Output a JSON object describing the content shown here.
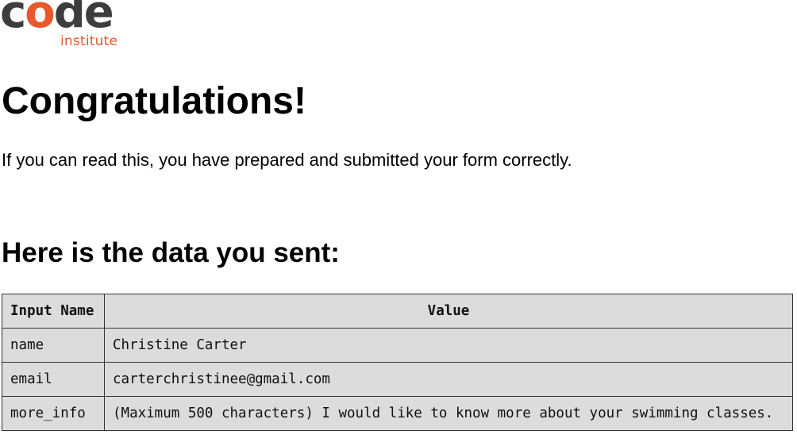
{
  "logo": {
    "word_prefix": "c",
    "word_accent": "o",
    "word_suffix": "de",
    "subtitle": "institute",
    "colors": {
      "primary": "#3d3d3d",
      "accent": "#e8582b"
    }
  },
  "page": {
    "title": "Congratulations!",
    "intro": "If you can read this, you have prepared and submitted your form correctly.",
    "section_heading": "Here is the data you sent:"
  },
  "table": {
    "headers": [
      "Input Name",
      "Value"
    ],
    "rows": [
      {
        "name": "name",
        "value": "Christine Carter"
      },
      {
        "name": "email",
        "value": "carterchristinee@gmail.com"
      },
      {
        "name": "more_info",
        "value": "(Maximum 500 characters) I would like to know more about your swimming classes."
      }
    ],
    "background": "#dcdcdc"
  }
}
